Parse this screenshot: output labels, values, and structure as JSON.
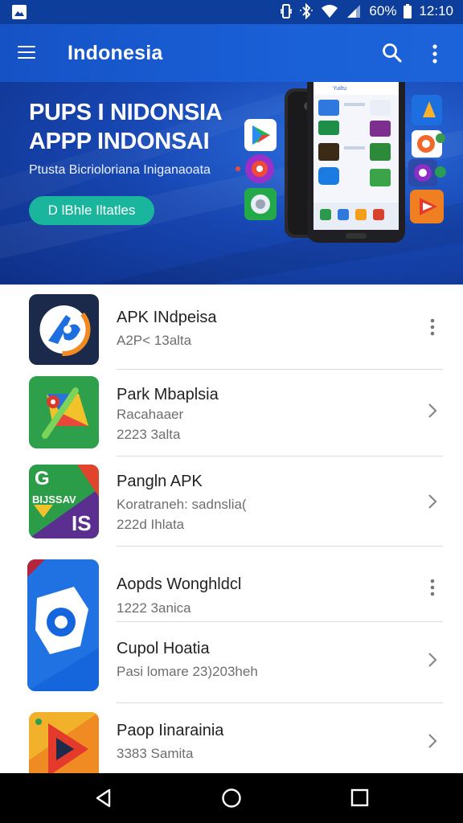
{
  "status_bar": {
    "battery_percent": "60%",
    "time": "12:10",
    "icons": [
      "image-icon",
      "vibrate-icon",
      "bluetooth-icon",
      "wifi-icon",
      "signal-icon",
      "battery-icon"
    ]
  },
  "app_bar": {
    "title": "Indonesia",
    "icons": [
      "menu-icon",
      "search-icon",
      "more-vert-icon"
    ]
  },
  "banner": {
    "title_line1": "PUPS I NIDONSIA",
    "title_line2": "APPP INDONSAI",
    "subtitle": "Ptusta Bicrioloriana Iniganaoata",
    "button_label": "D lBhle Iltatles",
    "button_color": "#19b69d",
    "phone_screen_text": "Yuiltu"
  },
  "apps": [
    {
      "name": "APK INdpeisa",
      "lines": [
        "A2P< 13alta"
      ],
      "trailing": "more-vert-icon"
    },
    {
      "name": "Park Mbaplsia",
      "lines": [
        "Racahaaer",
        "2223 3alta"
      ],
      "trailing": "chevron-right-icon"
    },
    {
      "name": "Pangln APK",
      "lines": [
        "Koratraneh: sadnslia(",
        "222d Ihlata"
      ],
      "trailing": "chevron-right-icon",
      "icon_text": {
        "top": "G",
        "middle": "BIJSSAV",
        "badge": "IS"
      }
    },
    {
      "name": "Aopds Wonghldcl",
      "lines": [
        "1222 3anica"
      ],
      "trailing": "more-vert-icon"
    },
    {
      "name": "Cupol Hoatia",
      "lines": [
        "Pasi lomare 23)203heh"
      ],
      "trailing": "chevron-right-icon"
    },
    {
      "name": "Paop Iinarainia",
      "lines": [
        "3383 Samita"
      ],
      "trailing": "chevron-right-icon"
    }
  ],
  "nav_bar": {
    "icons": [
      "back-icon",
      "home-icon",
      "recents-icon"
    ]
  },
  "colors": {
    "app_bar": "#1a5fd6",
    "status_bar": "#0d3e9b",
    "divider": "#dcdcdc"
  }
}
